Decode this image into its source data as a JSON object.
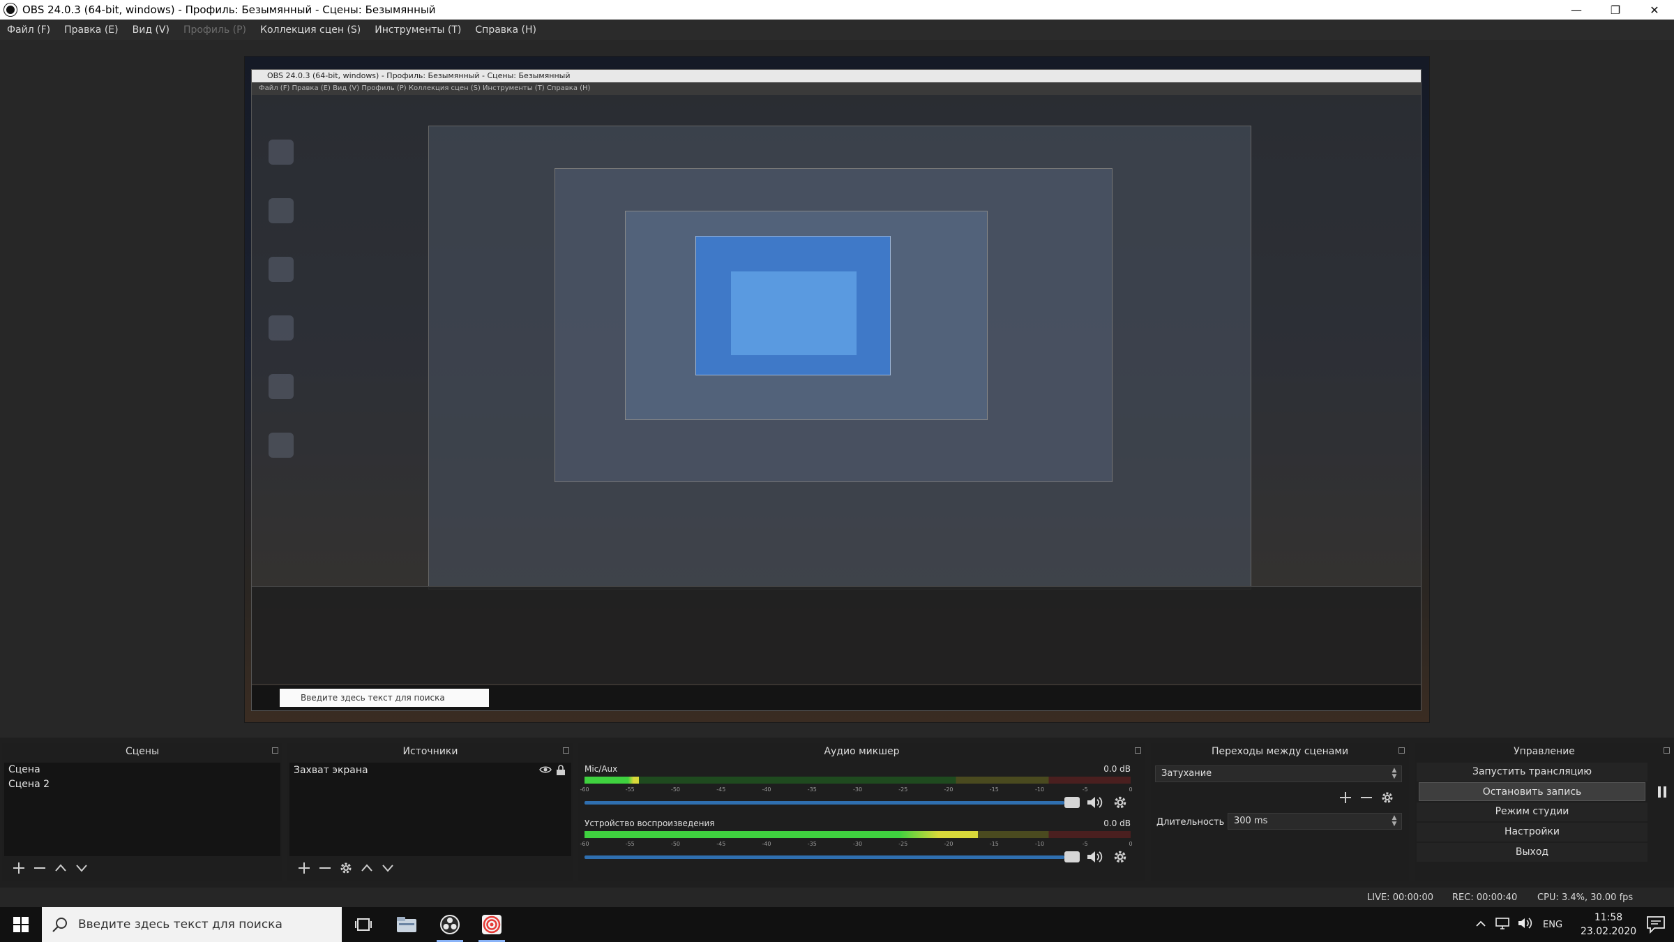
{
  "window": {
    "title": "OBS 24.0.3 (64-bit, windows) - Профиль: Безымянный - Сцены: Безымянный",
    "buttons": [
      "—",
      "❐",
      "✕"
    ]
  },
  "menu": [
    {
      "label": "Файл (F)",
      "enabled": true
    },
    {
      "label": "Правка (E)",
      "enabled": true
    },
    {
      "label": "Вид (V)",
      "enabled": true
    },
    {
      "label": "Профиль (P)",
      "enabled": false
    },
    {
      "label": "Коллекция сцен (S)",
      "enabled": true
    },
    {
      "label": "Инструменты (T)",
      "enabled": true
    },
    {
      "label": "Справка (H)",
      "enabled": true
    }
  ],
  "preview": {
    "nested_title": "OBS 24.0.3 (64-bit, windows) - Профиль: Безымянный - Сцены: Безымянный",
    "nested_menu": "Файл (F)   Правка (E)   Вид (V)   Профиль (P)   Коллекция сцен (S)   Инструменты (T)   Справка (H)",
    "nested_search": "Введите здесь текст для поиска"
  },
  "scenes": {
    "title": "Сцены",
    "items": [
      "Сцена",
      "Сцена 2"
    ]
  },
  "sources": {
    "title": "Источники",
    "items": [
      {
        "name": "Захват экрана"
      }
    ]
  },
  "mixer": {
    "title": "Аудио микшер",
    "ticks": [
      "-60",
      "-55",
      "-50",
      "-45",
      "-40",
      "-35",
      "-30",
      "-25",
      "-20",
      "-15",
      "-10",
      "-5",
      "0"
    ],
    "channels": [
      {
        "name": "Mic/Aux",
        "db": "0.0 dB",
        "level": 0.1
      },
      {
        "name": "Устройство воспроизведения",
        "db": "0.0 dB",
        "level": 0.72
      }
    ]
  },
  "transitions": {
    "title": "Переходы между сценами",
    "selected": "Затухание",
    "duration_label": "Длительность",
    "duration_value": "300 ms"
  },
  "controls": {
    "title": "Управление",
    "start_stream": "Запустить трансляцию",
    "stop_record": "Остановить запись",
    "studio_mode": "Режим студии",
    "settings": "Настройки",
    "exit": "Выход"
  },
  "status": {
    "live": "LIVE: 00:00:00",
    "rec": "REC: 00:00:40",
    "cpu": "CPU: 3.4%, 30.00 fps"
  },
  "taskbar": {
    "search_placeholder": "Введите здесь текст для поиска",
    "lang": "ENG",
    "time": "11:58",
    "date": "23.02.2020"
  }
}
